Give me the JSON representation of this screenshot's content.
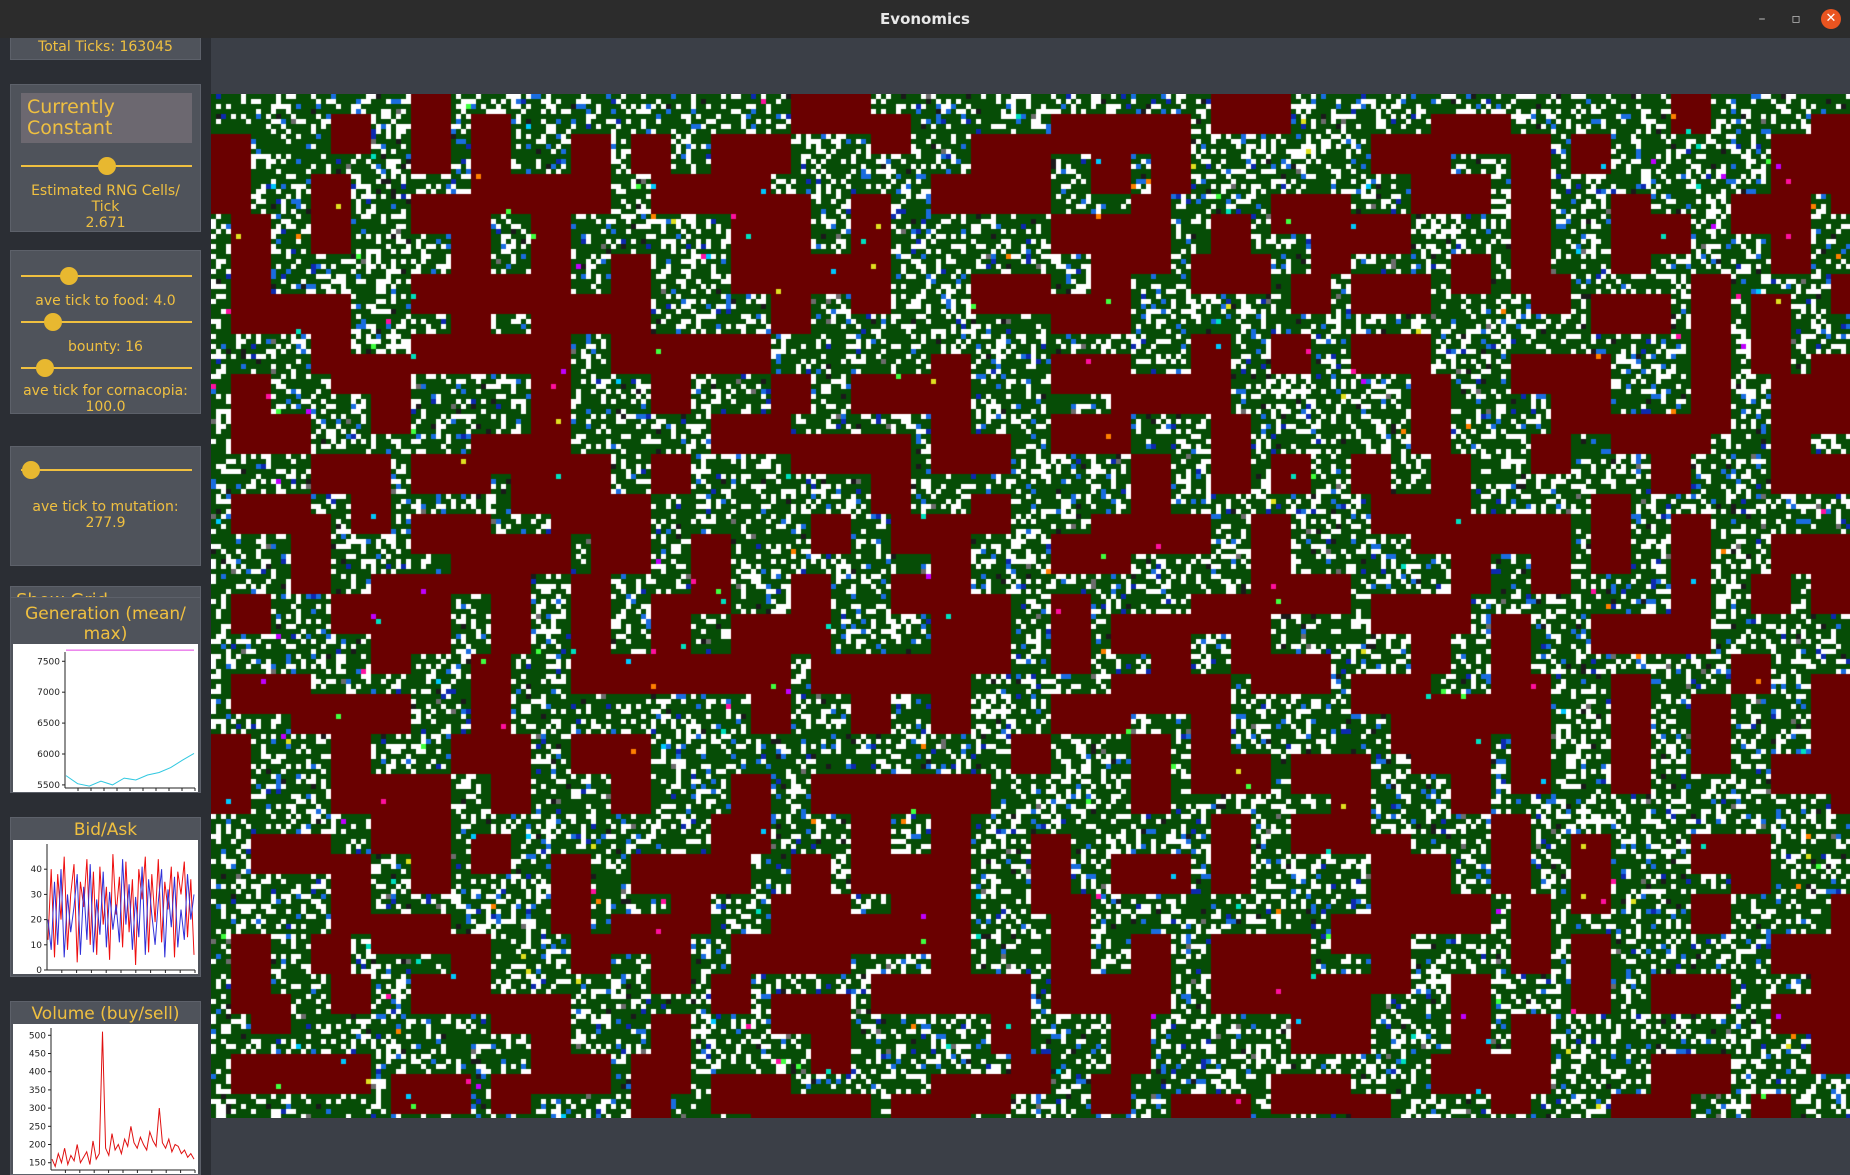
{
  "window": {
    "title": "Evonomics",
    "minimize": "–",
    "maximize": "▫",
    "close": "✕"
  },
  "sidebar": {
    "total_ticks": "Total Ticks: 163045",
    "rng_panel": {
      "mode_button": "Currently Constant",
      "slider_value": 0.5,
      "label": "Estimated RNG Cells/ Tick",
      "value": "2.671"
    },
    "params_panel": {
      "food_slider_value": 0.28,
      "food_label": "ave tick to food: 4.0",
      "bounty_slider_value": 0.19,
      "bounty_label": "bounty: 16",
      "cornucopia_slider_value": 0.14,
      "cornucopia_label": "ave tick for cornacopia:",
      "cornucopia_value": "100.0"
    },
    "mutation_panel": {
      "slider_value": 0.06,
      "label": "ave tick to mutation:",
      "value": "277.9"
    },
    "show_grid": "Show Grid",
    "generation_chart_title": "Generation (mean/ max)",
    "bidask_chart_title": "Bid/Ask",
    "volume_chart_title": "Volume (buy/sell)"
  },
  "chart_data": [
    {
      "type": "line",
      "title": "Generation (mean/ max)",
      "yticks": [
        "7500",
        "7000",
        "6500",
        "6000",
        "5500"
      ],
      "ylim": [
        5450,
        7650
      ],
      "series": [
        {
          "color": "#e040e0",
          "values": [
            7680,
            7680,
            7680,
            7680,
            7680,
            7680,
            7680,
            7680,
            7680,
            7680,
            7680,
            7680
          ]
        },
        {
          "color": "#30c8e0",
          "values": [
            5650,
            5520,
            5480,
            5560,
            5500,
            5610,
            5580,
            5660,
            5700,
            5780,
            5900,
            6010
          ]
        }
      ]
    },
    {
      "type": "line",
      "title": "Bid/Ask",
      "yticks": [
        "40",
        "30",
        "20",
        "10",
        "0"
      ],
      "ylim": [
        0,
        50
      ],
      "series": [
        {
          "color": "#ee1010",
          "values": [
            12,
            40,
            5,
            38,
            20,
            45,
            8,
            30,
            42,
            3,
            35,
            25,
            44,
            10,
            39,
            6,
            41,
            18,
            33,
            4,
            46,
            22,
            37,
            9,
            43,
            15,
            36,
            2,
            40,
            28,
            45,
            7,
            38,
            19,
            44,
            11,
            35,
            24,
            41,
            5,
            39,
            30,
            43,
            13,
            36,
            6
          ]
        },
        {
          "color": "#3030d8",
          "values": [
            20,
            8,
            35,
            10,
            40,
            5,
            30,
            15,
            25,
            38,
            6,
            33,
            12,
            42,
            7,
            28,
            14,
            39,
            9,
            31,
            16,
            26,
            11,
            44,
            18,
            34,
            8,
            29,
            13,
            41,
            6,
            36,
            22,
            10,
            27,
            40,
            5,
            32,
            17,
            37,
            9,
            24,
            12,
            38,
            20,
            30
          ]
        }
      ]
    },
    {
      "type": "line",
      "title": "Volume (buy/sell)",
      "yticks": [
        "500",
        "450",
        "400",
        "350",
        "300",
        "250",
        "200",
        "150"
      ],
      "ylim": [
        130,
        520
      ],
      "series": [
        {
          "color": "#e01010",
          "values": [
            160,
            140,
            175,
            150,
            190,
            145,
            170,
            155,
            200,
            150,
            165,
            180,
            145,
            210,
            160,
            175,
            510,
            190,
            170,
            230,
            185,
            200,
            175,
            215,
            195,
            250,
            205,
            190,
            220,
            200,
            185,
            235,
            210,
            195,
            300,
            205,
            190,
            215,
            180,
            200,
            195,
            175,
            185,
            165,
            175,
            160
          ]
        }
      ]
    }
  ]
}
